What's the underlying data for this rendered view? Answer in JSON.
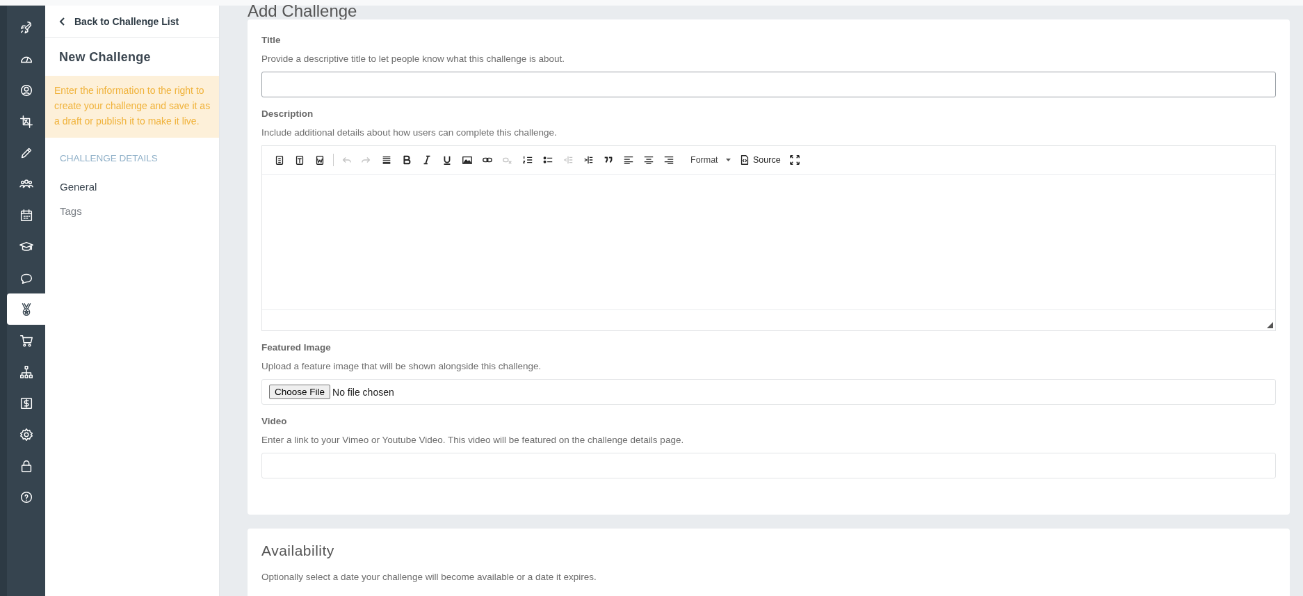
{
  "nav_rail": [
    {
      "selected": false
    },
    {
      "selected": false
    },
    {
      "selected": false
    },
    {
      "selected": false
    },
    {
      "selected": false
    },
    {
      "selected": false
    },
    {
      "selected": false
    },
    {
      "selected": false
    },
    {
      "selected": false
    },
    {
      "selected": true
    },
    {
      "selected": false
    },
    {
      "selected": false
    },
    {
      "selected": false
    },
    {
      "selected": false
    },
    {
      "selected": false
    },
    {
      "selected": false
    }
  ],
  "sidebar": {
    "back_link": "Back to Challenge List",
    "heading": "New Challenge",
    "notice": "Enter the information to the right to create your challenge and save it as a draft or publish it to make it live.",
    "section_title": "CHALLENGE DETAILS",
    "items": [
      {
        "label": "General",
        "selected": true
      },
      {
        "label": "Tags",
        "selected": false
      }
    ]
  },
  "page_title": "Add Challenge",
  "form": {
    "title": {
      "label": "Title",
      "help": "Provide a descriptive title to let people know what this challenge is about."
    },
    "description": {
      "label": "Description",
      "help": "Include additional details about how users can complete this challenge.",
      "toolbar": [
        {
          "disabled": false
        },
        {
          "disabled": false
        },
        {
          "disabled": false
        },
        {
          "kind": "separator"
        },
        {
          "disabled": true
        },
        {
          "disabled": true
        },
        {
          "disabled": false
        },
        {
          "disabled": false
        },
        {
          "disabled": false
        },
        {
          "disabled": false
        },
        {
          "disabled": false
        },
        {
          "disabled": false
        },
        {
          "disabled": true
        },
        {
          "disabled": false
        },
        {
          "disabled": false
        },
        {
          "disabled": true
        },
        {
          "disabled": false
        },
        {
          "disabled": false
        },
        {
          "disabled": false
        },
        {
          "disabled": false
        },
        {
          "disabled": false
        },
        {
          "kind": "dropdown",
          "label": "Format"
        },
        {
          "kind": "labeled",
          "label": "Source",
          "disabled": false
        },
        {
          "disabled": false
        }
      ]
    },
    "featured_image": {
      "label": "Featured Image",
      "help": "Upload a feature image that will be shown alongside this challenge.",
      "button": "Choose File",
      "status": "No file chosen"
    },
    "video": {
      "label": "Video",
      "help": "Enter a link to your Vimeo or Youtube Video. This video will be featured on the challenge details page."
    }
  },
  "availability": {
    "heading": "Availability",
    "help": "Optionally select a date your challenge will become available or a date it expires."
  }
}
